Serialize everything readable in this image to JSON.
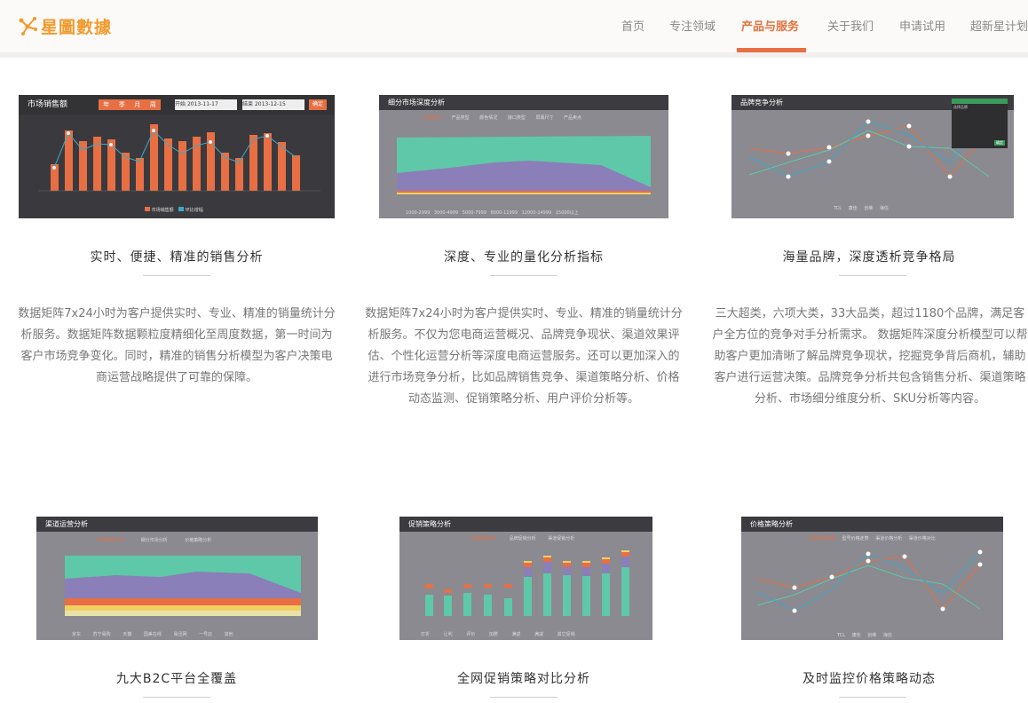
{
  "header": {
    "logo_text": "星圖數據",
    "nav": [
      "首页",
      "专注领域",
      "产品与服务",
      "关于我们",
      "申请试用",
      "超新星计划"
    ],
    "active_index": 2,
    "accent": "#e76f43"
  },
  "cards": [
    {
      "shot_title": "市场销售额",
      "title": "实时、便捷、精准的销售分析",
      "desc": "数据矩阵7x24小时为客户提供实时、专业、精准的销量统计分析服务。数据矩阵数据颗粒度精细化至周度数据，第一时间为客户市场竞争变化。同时，精准的销售分析模型为客户决策电商运营战略提供了可靠的保障。",
      "tabs": [
        "年",
        "季",
        "月",
        "周"
      ],
      "date_from_label": "开始",
      "date_from": "2013-11-17",
      "date_to_label": "结束",
      "date_to": "2013-12-15",
      "confirm": "确定",
      "legend": [
        "市场销售额",
        "环比增幅"
      ]
    },
    {
      "shot_title": "细分市场深度分析",
      "title": "深度、专业的量化分析指标",
      "desc": "数据矩阵7x24小时为客户提供实时、专业、精准的销量统计分析服务。不仅为您电商运营概况、品牌竞争现状、渠道效果评估、个性化运营分析等深度电商运营服务。还可以更加深入的进行市场竞争分析，比如品牌销售竞争、渠道策略分析、价格动态监测、促销策略分析、用户评价分析等。",
      "tabs": [
        "价格区间",
        "产品类型",
        "颜色情况",
        "接口类型",
        "屏幕尺寸",
        "产品卖点"
      ],
      "legend": [
        "1000-2999",
        "3000-4999",
        "5000-7999",
        "8000-11999",
        "12000-14999",
        "15000以上"
      ]
    },
    {
      "shot_title": "品牌竞争分析",
      "title": "海量品牌，深度透析竞争格局",
      "desc": "三大超类，六项大类，33大品类，超过1180个品牌，满足客户全方位的竞争对手分析需求。 数据矩阵深度分析模型可以帮助客户更加清晰了解品牌竞争现状，挖掘竞争背后商机，辅助客户进行运营决策。品牌竞争分析共包含销售分析、渠道策略分析、市场细分维度分析、SKU分析等内容。",
      "panel_title": "选择品牌",
      "panel_button": "确定",
      "legend": [
        "TCL",
        "康佳",
        "创维",
        "海信"
      ]
    },
    {
      "shot_title": "渠道运营分析",
      "title": "九大B2C平台全覆盖",
      "tabs": [
        "市场份额分析",
        "细分市场分析",
        "价格策略分析"
      ],
      "legend": [
        "京东",
        "苏宁易购",
        "天猫",
        "国美在线",
        "易迅网",
        "一号店",
        "其他"
      ]
    },
    {
      "shot_title": "促销策略分析",
      "title": "全网促销策略对比分析",
      "tabs": [
        "全网促销分析",
        "品牌促销分析",
        "渠道促销分析"
      ],
      "legend": [
        "打折",
        "让利",
        "评价",
        "加赠",
        "满返",
        "满减",
        "其它促销"
      ]
    },
    {
      "shot_title": "价格策略分析",
      "title": "及时监控价格策略动态",
      "tabs": [
        "品牌价格趋势",
        "型号价格走势",
        "渠道价格分析",
        "渠道价格对比"
      ],
      "legend": [
        "TCL",
        "康佳",
        "创维",
        "海信"
      ]
    }
  ]
}
